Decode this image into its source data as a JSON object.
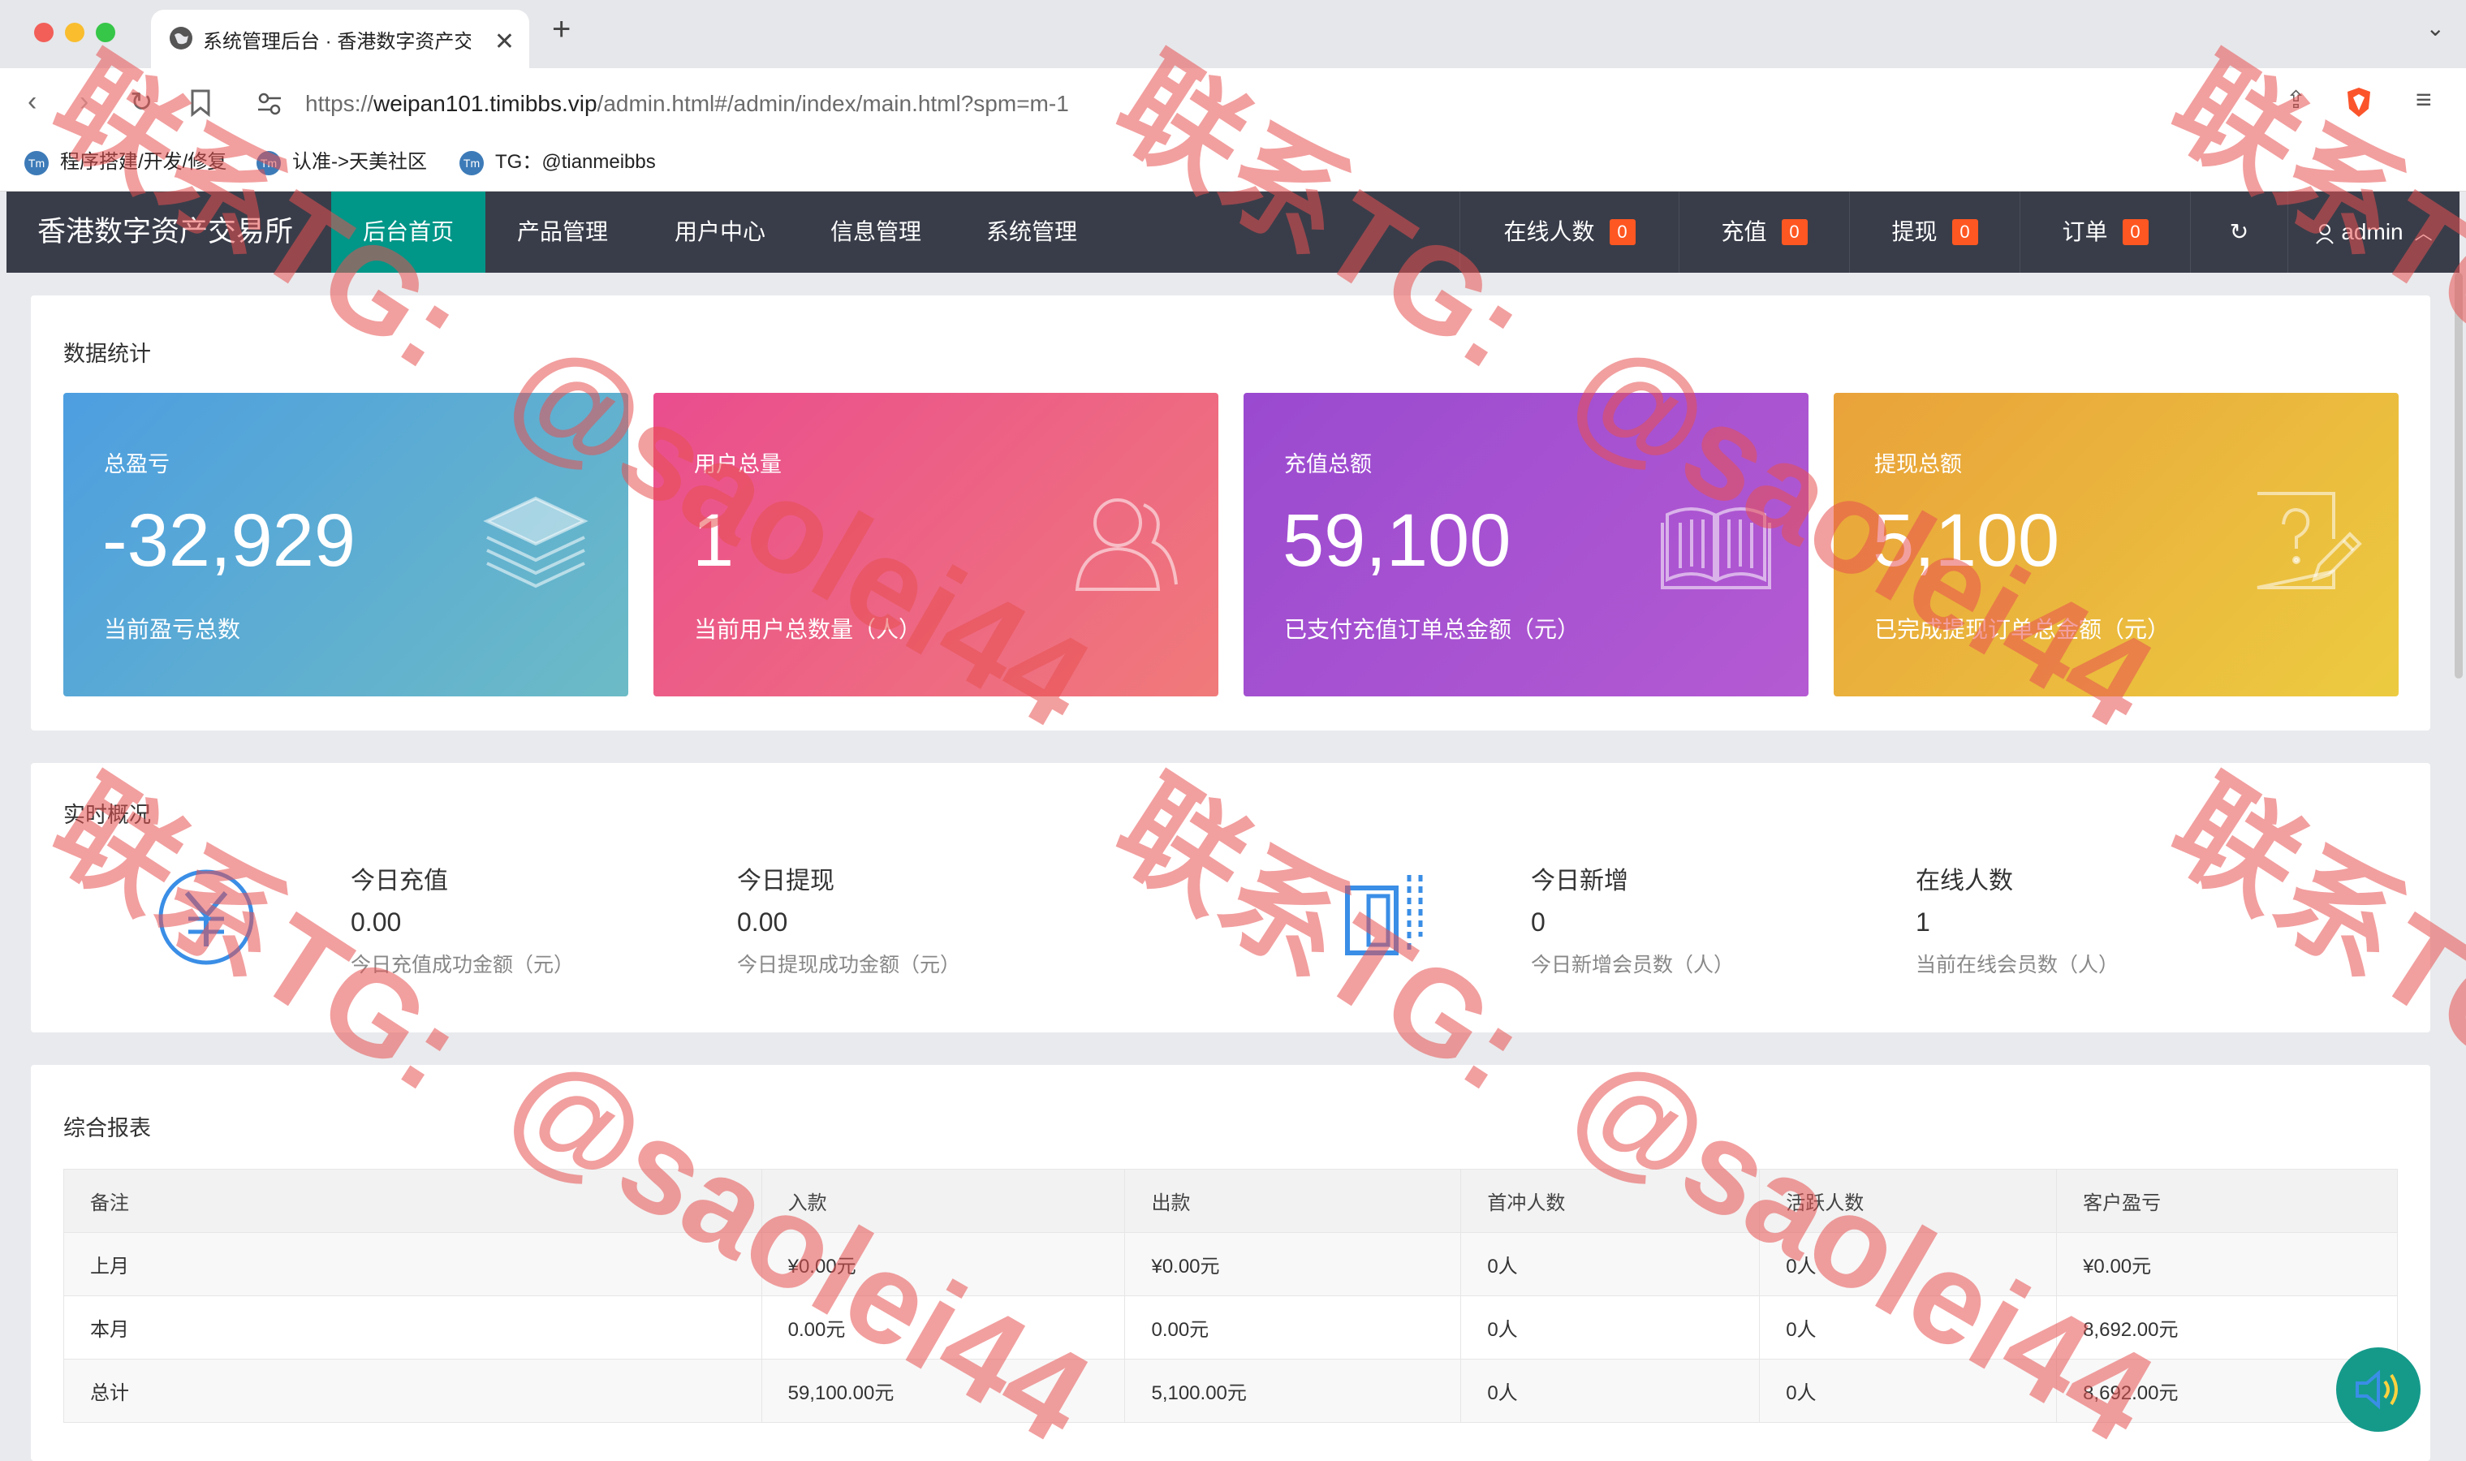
{
  "browser": {
    "tab_title": "系统管理后台 · 香港数字资产交",
    "url_prefix": "https://",
    "url_host": "weipan101.timibbs.vip",
    "url_path": "/admin.html#/admin/index/main.html?spm=m-1",
    "bookmarks": [
      "程序搭建/开发/修复",
      "认准->天美社区",
      "TG：@tianmeibbs"
    ]
  },
  "app": {
    "logo": "香港数字资产交易所",
    "nav": [
      "后台首页",
      "产品管理",
      "用户中心",
      "信息管理",
      "系统管理"
    ],
    "right_nav": [
      {
        "label": "在线人数",
        "badge": "0"
      },
      {
        "label": "充值",
        "badge": "0"
      },
      {
        "label": "提现",
        "badge": "0"
      },
      {
        "label": "订单",
        "badge": "0"
      }
    ],
    "user": "admin"
  },
  "stats": {
    "title": "数据统计",
    "cards": [
      {
        "title": "总盈亏",
        "value": "-32,929",
        "sub": "当前盈亏总数",
        "icon": "layers-icon"
      },
      {
        "title": "用户总量",
        "value": "1",
        "sub": "当前用户总数量（人）",
        "icon": "users-icon"
      },
      {
        "title": "充值总额",
        "value": "59,100",
        "sub": "已支付充值订单总金额（元）",
        "icon": "book-icon"
      },
      {
        "title": "提现总额",
        "value": "5,100",
        "sub": "已完成提现订单总金额（元）",
        "icon": "help-doc-icon"
      }
    ]
  },
  "realtime": {
    "title": "实时概况",
    "items": [
      {
        "label": "今日充值",
        "value": "0.00",
        "desc": "今日充值成功金额（元）"
      },
      {
        "label": "今日提现",
        "value": "0.00",
        "desc": "今日提现成功金额（元）"
      },
      {
        "label": "今日新增",
        "value": "0",
        "desc": "今日新增会员数（人）"
      },
      {
        "label": "在线人数",
        "value": "1",
        "desc": "当前在线会员数（人）"
      }
    ]
  },
  "report": {
    "title": "综合报表",
    "headers": [
      "备注",
      "入款",
      "出款",
      "首冲人数",
      "活跃人数",
      "客户盈亏"
    ],
    "rows": [
      [
        "上月",
        "¥0.00元",
        "¥0.00元",
        "0人",
        "0人",
        "¥0.00元"
      ],
      [
        "本月",
        "0.00元",
        "0.00元",
        "0人",
        "0人",
        "8,692.00元"
      ],
      [
        "总计",
        "59,100.00元",
        "5,100.00元",
        "0人",
        "0人",
        "8,692.00元"
      ]
    ]
  },
  "watermarks": {
    "contact": "联系TG:",
    "handle": "@saolei44"
  },
  "colors": {
    "header_bg": "#393d49",
    "active_nav": "#009688",
    "badge": "#ff5722"
  }
}
